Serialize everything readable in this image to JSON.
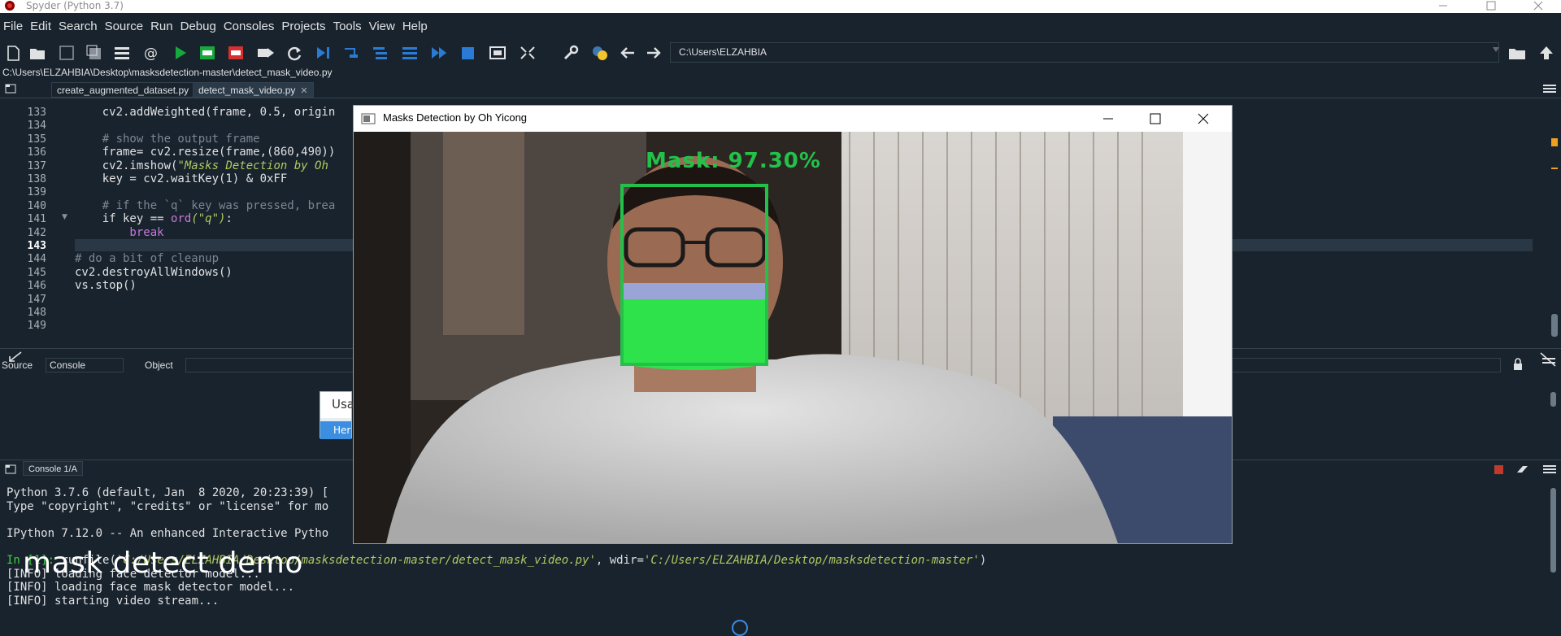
{
  "window": {
    "title": "Spyder (Python 3.7)"
  },
  "menubar": [
    "File",
    "Edit",
    "Search",
    "Source",
    "Run",
    "Debug",
    "Consoles",
    "Projects",
    "Tools",
    "View",
    "Help"
  ],
  "toolbar": {
    "path": "C:\\Users\\ELZAHBIA"
  },
  "editor": {
    "file_path": "C:\\Users\\ELZAHBIA\\Desktop\\masksdetection-master\\detect_mask_video.py",
    "tabs": [
      {
        "label": "create_augmented_dataset.py",
        "active": false
      },
      {
        "label": "detect_mask_video.py",
        "active": true
      }
    ],
    "lines": [
      {
        "num": "133",
        "text": "    cv2.addWeighted(frame, 0.5, origin"
      },
      {
        "num": "134",
        "text": ""
      },
      {
        "num": "135",
        "text": "    # show the output frame"
      },
      {
        "num": "136",
        "text": "    frame= cv2.resize(frame,(860,490))"
      },
      {
        "num": "137",
        "text_a": "    cv2.imshow(",
        "text_b": "\"Masks Detection by Oh"
      },
      {
        "num": "138",
        "text": "    key = cv2.waitKey(1) & 0xFF"
      },
      {
        "num": "139",
        "text": ""
      },
      {
        "num": "140",
        "text": "    # if the `q` key was pressed, brea"
      },
      {
        "num": "141",
        "text_a": "    if key == ",
        "text_b": "ord",
        "text_c": "(\"q\")",
        "text_d": ":"
      },
      {
        "num": "142",
        "text": "        break"
      },
      {
        "num": "143",
        "text": ""
      },
      {
        "num": "144",
        "text": "# do a bit of cleanup"
      },
      {
        "num": "145",
        "text": "cv2.destroyAllWindows()"
      },
      {
        "num": "146",
        "text": "vs.stop()"
      },
      {
        "num": "147",
        "text": ""
      },
      {
        "num": "148",
        "text": ""
      },
      {
        "num": "149",
        "text": ""
      }
    ]
  },
  "help": {
    "source_label": "Source",
    "source_value": "Console",
    "object_label": "Object",
    "usage_title": "Usa",
    "usage_link": "Her"
  },
  "console": {
    "tab_label": "Console 1/A",
    "lines": {
      "l1": "Python 3.7.6 (default, Jan  8 2020, 20:23:39) [",
      "l2": "Type \"copyright\", \"credits\" or \"license\" for mo",
      "l3": "IPython 7.12.0 -- An enhanced Interactive Pytho",
      "prompt": "In [1]: ",
      "run_a": "runfile(",
      "run_b": "'C:/Users/ELZAHBIA/Desktop/masksdetection-master/detect_mask_video.py'",
      "run_c": ", wdir=",
      "run_d": "'C:/Users/ELZAHBIA/Desktop/masksdetection-master'",
      "run_e": ")",
      "l5": "[INFO] loading face detector model...",
      "l6": "[INFO] loading face mask detector model...",
      "l7": "[INFO] starting video stream..."
    }
  },
  "overlay": {
    "caption": "mask detect  demo"
  },
  "video_window": {
    "title": "Masks Detection by Oh Yicong",
    "label": "Mask: 97.30%"
  },
  "colors": {
    "bg": "#19232d",
    "detect_green": "#23c14a"
  }
}
